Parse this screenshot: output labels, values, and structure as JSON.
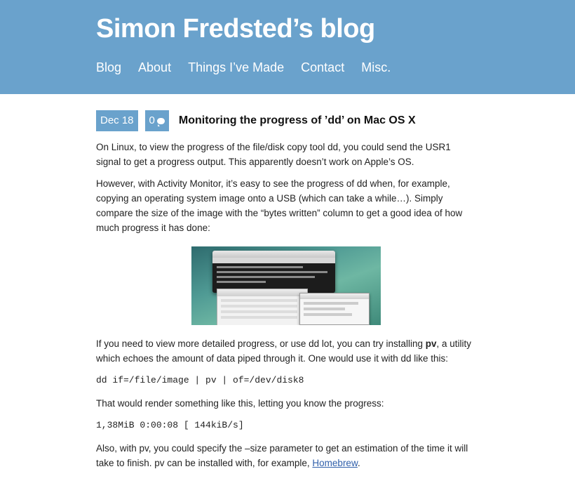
{
  "site": {
    "title": "Simon Fredsted’s blog",
    "nav": [
      "Blog",
      "About",
      "Things I’ve Made",
      "Contact",
      "Misc."
    ]
  },
  "post": {
    "date": "Dec 18",
    "comments": "0",
    "title": "Monitoring the progress of ’dd’ on Mac OS X",
    "p1": "On Linux, to view the progress of the file/disk copy tool dd, you could send the USR1 signal to get a progress output. This apparently doesn’t work on Apple’s OS.",
    "p2": "However, with Activity Monitor, it’s easy to see the progress of dd when, for example, copying an operating system image onto a USB (which can take a while…). Simply compare the size of the image with the “bytes written” column to get a good idea of how much progress it has done:",
    "p3_before": "If you need to view more detailed progress, or use dd lot, you can try installing ",
    "p3_bold": "pv",
    "p3_after": ", a utility which echoes the amount of data piped through it. One would use it with dd like this:",
    "code1": "dd if=/file/image | pv | of=/dev/disk8",
    "p4": "That would render something like this, letting you know the progress:",
    "code2": "1,38MiB 0:00:08 [  144kiB/s]",
    "p5_before": "Also, with pv, you could specify the –size parameter to get an estimation of the time it will take to finish. pv can be installed with, for example, ",
    "p5_link": "Homebrew",
    "p5_after": "."
  }
}
